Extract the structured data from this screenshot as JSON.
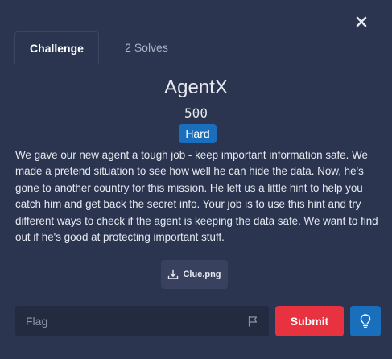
{
  "tabs": [
    {
      "label": "Challenge",
      "active": true
    },
    {
      "label": "2 Solves",
      "active": false
    }
  ],
  "challenge": {
    "title": "AgentX",
    "points": "500",
    "difficulty": "Hard",
    "description": "We gave our new agent a tough job - keep important information safe. We made a pretend situation to see how well he can hide the data. Now, he's gone to another country for this mission. He left us a little hint to help you catch him and get back the secret info. Your job is to use this hint and try different ways to check if the agent is keeping the data safe. We want to find out if he's good at protecting important stuff."
  },
  "file": {
    "name": "Clue.png",
    "icon": "download-icon"
  },
  "flag_form": {
    "placeholder": "Flag",
    "value": "",
    "flag_icon": "flag-icon",
    "submit_label": "Submit",
    "hint_icon": "lightbulb-icon"
  },
  "close_icon": "close-icon",
  "colors": {
    "background": "#2b3550",
    "input_background": "#222b40",
    "badge": "#1a6fbd",
    "submit": "#e8323f",
    "hint": "#1a6fbd"
  }
}
